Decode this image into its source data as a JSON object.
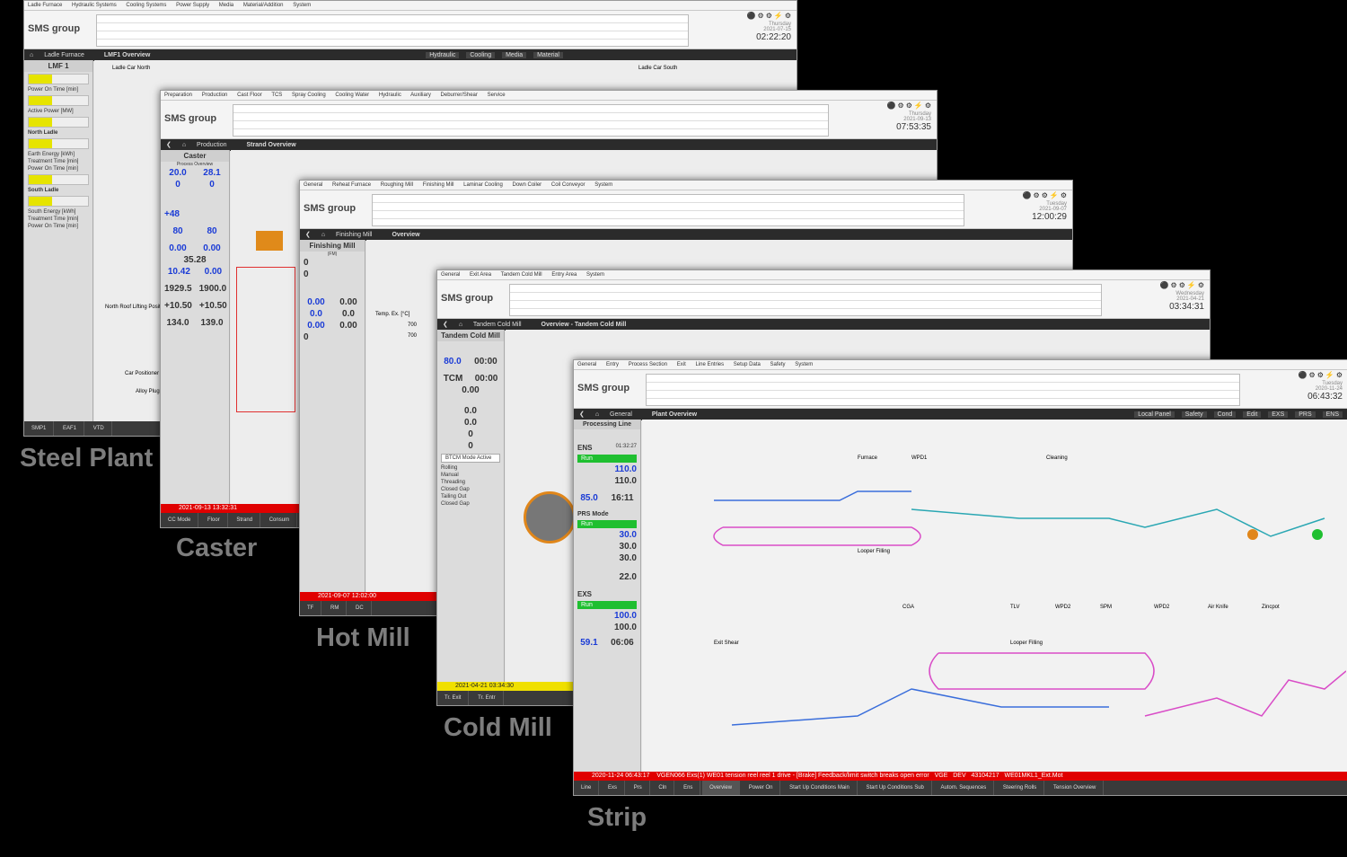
{
  "labels": {
    "steel_plant": "Steel Plant",
    "caster": "Caster",
    "hot_mill": "Hot Mill",
    "cold_mill": "Cold Mill",
    "strip": "Strip"
  },
  "brand": {
    "logo": "SMS group",
    "accent": "#d02020"
  },
  "steel_plant": {
    "menu": [
      "Ladle Furnace",
      "Hydraulic Systems",
      "Cooling Systems",
      "Power Supply",
      "Media",
      "Material/Addition",
      "System"
    ],
    "clock": {
      "day": "Thursday",
      "date": "2021-07-15",
      "time": "02:22:20"
    },
    "nav": {
      "area": "Ladle Furnace",
      "view": "LMF1 Overview"
    },
    "nav_right": [
      "Hydraulic",
      "Cooling",
      "Media",
      "Material"
    ],
    "side_title": "LMF 1",
    "side_items": [
      "Power On Time [min]",
      "Active Power [MW]",
      "North Ladle",
      "Earth Energy [kWh]",
      "Treatment Time [min]",
      "Power On Time [min]",
      "South Ladle",
      "South Energy [kWh]",
      "Treatment Time [min]",
      "Power On Time [min]"
    ],
    "canvas_labels": [
      "Ladle Car North",
      "Ladle Car South",
      "North Roof Lifting Position",
      "Car Positioner",
      "Alloy Plug"
    ],
    "footer": [
      "SMP1",
      "EAF1",
      "VTD"
    ]
  },
  "caster": {
    "menu": [
      "Preparation",
      "Production",
      "Cast Floor",
      "TCS",
      "Spray Cooling",
      "Cooling Water",
      "Hydraulic",
      "Auxiliary",
      "Deburrer/Shear",
      "Service"
    ],
    "clock": {
      "day": "Thursday",
      "date": "2021-09-13",
      "time": "07:53:35"
    },
    "nav": {
      "area": "Production",
      "view": "Strand Overview"
    },
    "side_title": "Caster",
    "side_sub": "Process Overview",
    "values": [
      "20.0",
      "28.1",
      "0",
      "0",
      "+48",
      "80",
      "80",
      "0.00",
      "0.00",
      "35.28",
      "10.42",
      "0.00",
      "1929.5",
      "1900.0",
      "+10.50",
      "+10.50",
      "134.0",
      "139.0"
    ],
    "status": "2021-09-13 13:32:31",
    "footer": [
      "CC Mode",
      "Floor",
      "Strand",
      "Consum"
    ]
  },
  "hot_mill": {
    "menu": [
      "General",
      "Reheat Furnace",
      "Roughing Mill",
      "Finishing Mill",
      "Laminar Cooling",
      "Down Coiler",
      "Coil Conveyor",
      "System"
    ],
    "clock": {
      "day": "Tuesday",
      "date": "2021-09-07",
      "time": "12:00:29"
    },
    "nav": {
      "area": "Finishing Mill",
      "view": "Overview"
    },
    "side_title": "Finishing Mill",
    "side_sub": "(FM)",
    "values": [
      "0",
      "0",
      "0.00",
      "0.00",
      "0.0",
      "0.0",
      "0.00",
      "0.00",
      "0"
    ],
    "temp": {
      "label": "Temp. Ex. [°C]",
      "pyro1": "700",
      "pyro2": "700"
    },
    "status": "2021-09-07 12:02:00",
    "footer": [
      "TF",
      "RM",
      "DC"
    ]
  },
  "cold_mill": {
    "menu": [
      "General",
      "Exit Area",
      "Tandem Cold Mill",
      "Entry Area",
      "System"
    ],
    "clock": {
      "day": "Wednesday",
      "date": "2021-04-21",
      "time": "03:34:31"
    },
    "nav": {
      "area": "Tandem Cold Mill",
      "view": "Overview - Tandem Cold Mill"
    },
    "side_title": "Tandem Cold Mill",
    "values": {
      "looper": "80.0",
      "looper_time": "00:00",
      "tcm": "TCM",
      "tcm_time": "00:00",
      "speed": "0.00",
      "dist1": "0.0",
      "dist2": "0.0",
      "dist3": "0",
      "dist4": "0"
    },
    "mode": "BTCM Mode Active",
    "production": [
      "Rolling",
      "Manual",
      "Threading",
      "Closed Gap",
      "Tailing Out",
      "Closed Gap"
    ],
    "status": "2021-04-21 03:34:30",
    "footer": [
      "Tr. Exit",
      "Tr. Entr"
    ]
  },
  "strip": {
    "menu": [
      "General",
      "Entry",
      "Process Section",
      "Exit",
      "Line Entries",
      "Setup Data",
      "Safety",
      "System"
    ],
    "clock": {
      "day": "Tuesday",
      "date": "2020-11-24",
      "time": "06:43:32"
    },
    "nav": {
      "area": "General",
      "view": "Plant Overview"
    },
    "nav_right": [
      "Local Panel",
      "Safety",
      "Cond",
      "Edit",
      "EXS",
      "PRS",
      "ENS"
    ],
    "side_title": "Processing Line",
    "ens": {
      "label": "ENS",
      "time": "01:32:27",
      "run": "Run",
      "ref": "110.0",
      "act": "110.0",
      "looper": "85.0",
      "looper_time": "16:11"
    },
    "prs": {
      "label": "PRS Mode",
      "run": "Run",
      "max": "30.0",
      "ref": "30.0",
      "act": "30.0",
      "capacity": "22.0"
    },
    "exs": {
      "label": "EXS",
      "run": "Run",
      "ref": "100.0",
      "act": "100.0",
      "looper": "59.1",
      "looper_time": "06:06"
    },
    "sections": [
      "Furnace",
      "WPD1",
      "Cleaning",
      "Looper Filling",
      "CGA",
      "TLV",
      "WPD2",
      "SPM",
      "WPD2",
      "Air Knife",
      "Zincpot",
      "Exit Shear",
      "Looper Filling"
    ],
    "status": "2020-11-24 06:43:17",
    "alarm": "VGEN066 Exs(1) WE01 tension reel reel 1 drive - [Brake] Feedback/limit switch breaks open error",
    "alarm_tags": [
      "VGE",
      "DEV",
      "43104217",
      "WE01MKL1_Ext.Mot"
    ],
    "footer": [
      "Line",
      "Exs",
      "Prs",
      "Cln",
      "Ens",
      "Overview",
      "Power On",
      "Start Up Conditions Main",
      "Start Up Conditions Sub",
      "Autom. Sequences",
      "Steering Rolls",
      "Tension Overview"
    ]
  }
}
